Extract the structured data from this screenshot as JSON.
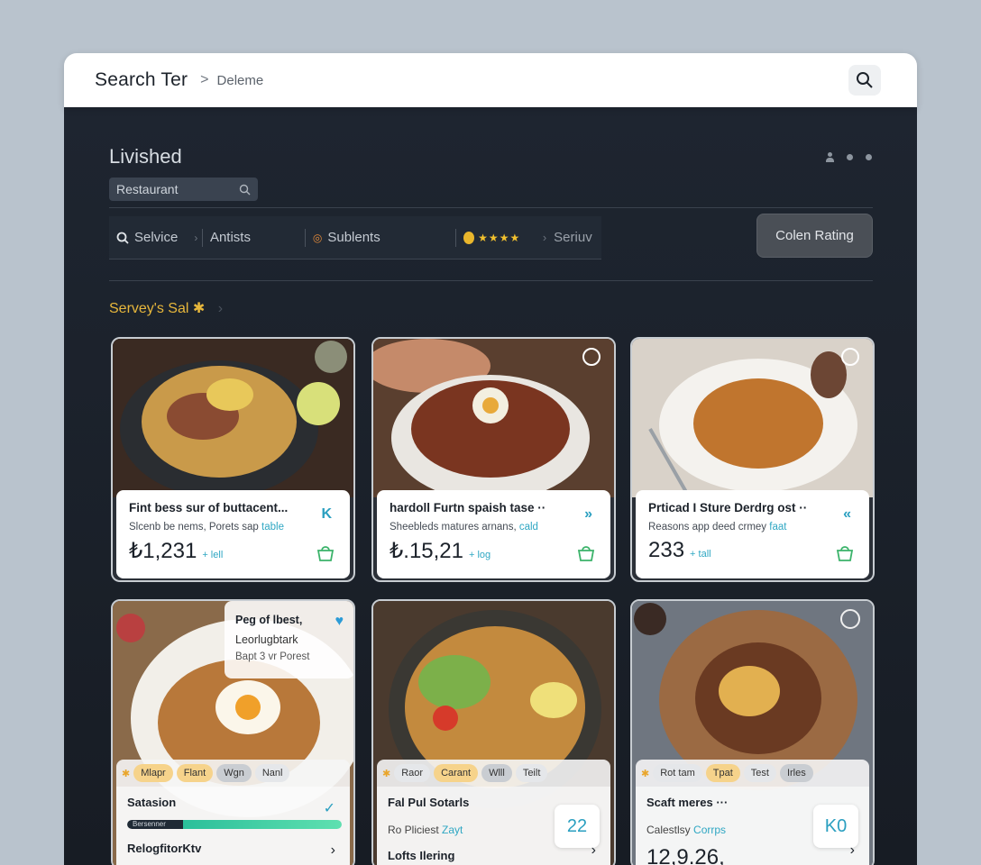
{
  "header": {
    "title": "Search Ter",
    "breadcrumb": "Deleme"
  },
  "panel": {
    "title": "Livished",
    "category_pill": "Restaurant",
    "filters": [
      {
        "label": "Selvice"
      },
      {
        "label": "Antists"
      },
      {
        "label": "Sublents"
      },
      {
        "label": "Seriuv"
      }
    ],
    "rating_stars": "★★★★",
    "rating_button": "Colen Rating",
    "section_title": "Servey's Sal"
  },
  "cards": [
    {
      "name": "Fint bess sur of buttacent...",
      "desc": "Slcenb be nems, Porets sap",
      "desc_link": "table",
      "price": "₺1,231",
      "price_sub": "+ lell",
      "nav": "K"
    },
    {
      "name": "hardoll Furtn spaish tase ··",
      "desc": "Sheebleds matures arnans,",
      "desc_link": "cald",
      "price": "₺.15,21",
      "price_sub": "+ log",
      "nav": "»"
    },
    {
      "name": "Prticad I Sture Derdrg ost ··",
      "desc": "Reasons app deed crmey",
      "desc_link": "faat",
      "price": "233",
      "price_sub": "+ tall",
      "nav": "«"
    }
  ],
  "row2": [
    {
      "overlay": {
        "l1": "Peg of lbest,",
        "l2": "Leorlugbtark",
        "l3": "Bapt 3 vr Porest"
      },
      "tags": [
        "Mlapr",
        "Flant",
        "Wgn",
        "Nanl"
      ],
      "title": "Satasion",
      "progress_label": "Bersenner",
      "progress_value": 0.26,
      "footer": "RelogfitorKtv"
    },
    {
      "tags": [
        "Raor",
        "Carant",
        "Wlll",
        "Teilt"
      ],
      "title": "Fal Pul Sotarls",
      "sub": "Ro Pliciest",
      "sub_link": "Zayt",
      "box": "22",
      "footer": "Lofts Ilering"
    },
    {
      "tags": [
        "Rot tam",
        "Tpat",
        "Test",
        "Irles"
      ],
      "title": "Scaft meres ···",
      "sub": "Calestlsy",
      "sub_link": "Corrps",
      "box": "K0",
      "number": "12,9.26,"
    }
  ]
}
